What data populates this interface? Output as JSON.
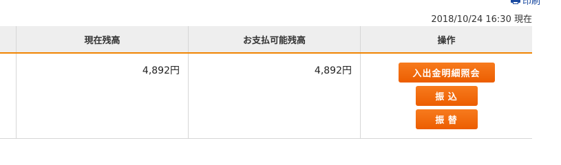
{
  "header": {
    "print_label": "印刷",
    "timestamp": "2018/10/24 16:30 現在"
  },
  "table": {
    "columns": [
      "",
      "現在残高",
      "お支払可能残高",
      "操作"
    ],
    "row": {
      "current_balance": "4,892円",
      "available_balance": "4,892円"
    }
  },
  "actions": {
    "statement_inquiry": "入出金明細照会",
    "transfer": "振 込",
    "account_transfer": "振 替"
  }
}
